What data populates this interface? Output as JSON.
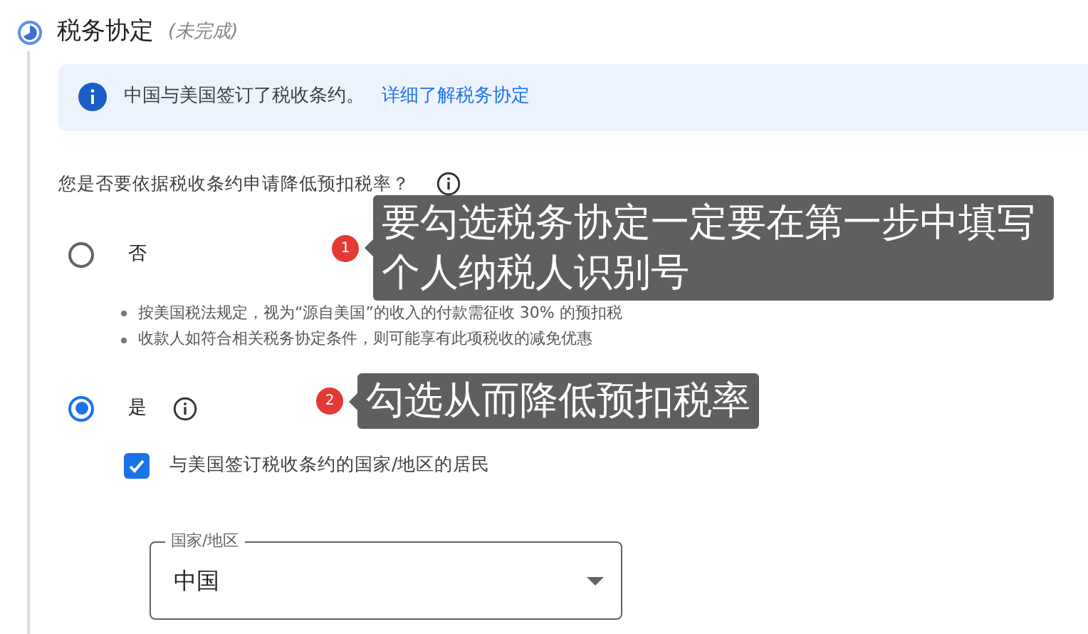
{
  "step": {
    "title": "税务协定",
    "status": "(未完成)"
  },
  "notice": {
    "text": "中国与美国签订了税收条约。",
    "link": "详细了解税务协定"
  },
  "question": "您是否要依据税收条约申请降低预扣税率？",
  "options": [
    {
      "label": "否",
      "selected": false,
      "notes": [
        "按美国税法规定，视为“源自美国”的收入的付款需征收 30% 的预扣税",
        "收款人如符合相关税务协定条件，则可能享有此项税收的减免优惠"
      ]
    },
    {
      "label": "是",
      "selected": true,
      "info": true
    }
  ],
  "resident_checkbox": {
    "label": "与美国签订税收条约的国家/地区的居民",
    "checked": true
  },
  "country_select": {
    "label": "国家/地区",
    "value": "中国"
  },
  "annotations": [
    {
      "number": "1",
      "text": "要勾选税务协定一定要在第一步中填写个人纳税人识别号"
    },
    {
      "number": "2",
      "text": "勾选从而降低预扣税率"
    }
  ]
}
